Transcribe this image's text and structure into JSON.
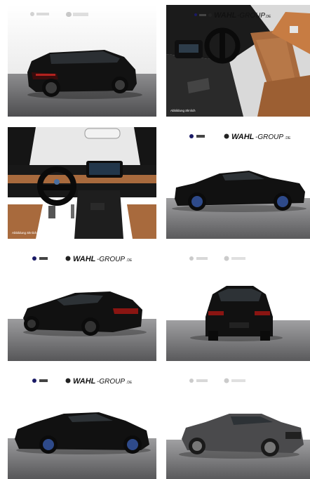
{
  "dealer": {
    "name_bold": "WAHL",
    "name_rest": "-GROUP",
    "domain": ".DE"
  },
  "caption": "Abbildung ähnlich",
  "tiles": [
    {
      "id": "tile-1",
      "scene": "touring-rear",
      "logo": "blurred",
      "caption": false
    },
    {
      "id": "tile-2",
      "scene": "interior-seats",
      "logo": "small",
      "caption": true
    },
    {
      "id": "tile-3",
      "scene": "interior-dashboard",
      "logo": "none",
      "caption": true
    },
    {
      "id": "tile-4",
      "scene": "coupe-side",
      "logo": "full",
      "caption": false
    },
    {
      "id": "tile-5",
      "scene": "coupe-rear-three-quarter",
      "logo": "full",
      "caption": false
    },
    {
      "id": "tile-6",
      "scene": "hatch-rear",
      "logo": "blurred",
      "caption": false
    },
    {
      "id": "tile-7",
      "scene": "coupe-front-three-quarter",
      "logo": "full",
      "caption": false
    },
    {
      "id": "tile-8",
      "scene": "sedan-front-three-quarter",
      "logo": "blurred",
      "caption": false
    }
  ],
  "colors": {
    "car_black": "#111111",
    "car_grey": "#4a4a4c",
    "floor": "#5b5b5d",
    "leather": "#a86a3d",
    "interior_dark": "#1a1a1a"
  }
}
